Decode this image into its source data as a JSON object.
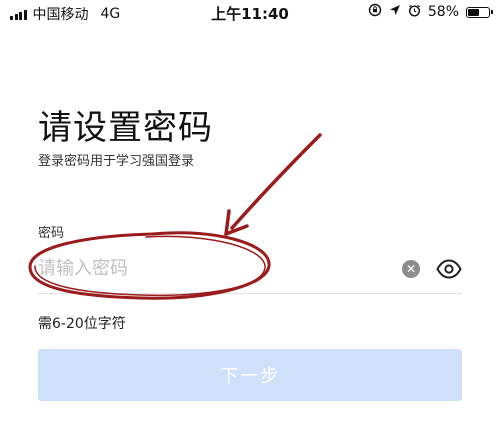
{
  "status_bar": {
    "carrier": "中国移动",
    "network": "4G",
    "time": "上午11:40",
    "battery_percent_label": "58%",
    "battery_level": 0.58,
    "icons": [
      "signal-icon",
      "lock-rotation-icon",
      "location-icon",
      "alarm-icon",
      "battery-icon"
    ]
  },
  "page": {
    "title": "请设置密码",
    "subtitle": "登录密码用于学习强国登录"
  },
  "password_field": {
    "label": "密码",
    "placeholder": "请输入密码",
    "value": "",
    "clear_icon": "clear-icon",
    "visibility_icon": "eye-icon"
  },
  "hint": "需6-20位字符",
  "next_button": {
    "label": "下一步",
    "background": "#cfe0fb",
    "enabled": false
  },
  "annotation": {
    "color": "#9b1c1c",
    "shapes": [
      "arrow",
      "ellipse"
    ]
  }
}
